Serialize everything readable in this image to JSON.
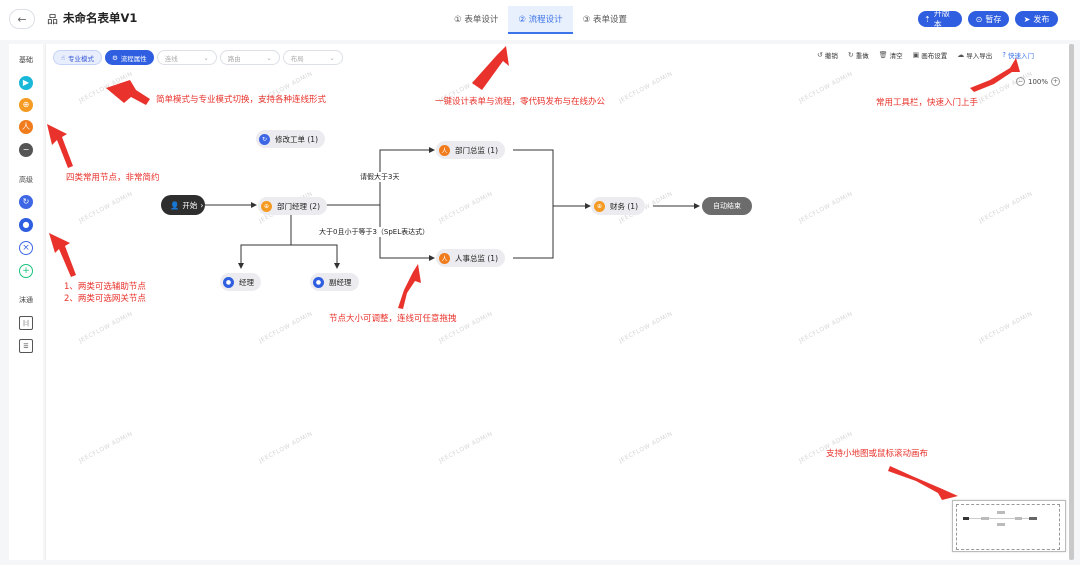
{
  "header": {
    "back_icon": "←",
    "form_icon": "品",
    "title": "未命名表单V1",
    "steps": [
      "① 表单设计",
      "② 流程设计",
      "③ 表单设置"
    ],
    "active_step": 1,
    "buttons": [
      {
        "icon": "⇡",
        "label": "升版本"
      },
      {
        "icon": "⊙",
        "label": "暂存"
      },
      {
        "icon": "➤",
        "label": "发布"
      }
    ]
  },
  "sidebar": {
    "sections": [
      "基础",
      "高级",
      "沫通"
    ]
  },
  "toolbar": {
    "mode_simple": "专业模式",
    "mode_pro": "流程属性",
    "selects": [
      "连线",
      "路由",
      "布局"
    ],
    "tools": [
      {
        "icon": "↺",
        "label": "撤销"
      },
      {
        "icon": "↻",
        "label": "重做"
      },
      {
        "icon": "🗑",
        "label": "清空"
      },
      {
        "icon": "▣",
        "label": "画布设置"
      },
      {
        "icon": "☁",
        "label": "导入导出"
      },
      {
        "icon": "?",
        "label": "快速入门"
      }
    ],
    "zoom": "100%"
  },
  "flow": {
    "start": "开始",
    "end": "自动结束",
    "nodes": {
      "modify": "修改工单 (1)",
      "dept_manager": "部门经理 (2)",
      "dept_director": "部门总监 (1)",
      "hr_director": "人事总监 (1)",
      "finance": "财务 (1)",
      "manager": "经理",
      "vice_manager": "副经理"
    },
    "edge_labels": {
      "leave_gt3": "请假大于3天",
      "leave_range": "大于0且小于等于3（SpEL表达式）"
    }
  },
  "annotations": {
    "mode_switch": "简单模式与专业模式切换，支持各种连线形式",
    "one_click": "一键设计表单与流程，零代码发布与在线办公",
    "toolbar_tip": "常用工具栏，快速入门上手",
    "four_nodes": "四类常用节点，非常简约",
    "aux_nodes_1": "1、两类可选辅助节点",
    "aux_nodes_2": "2、两类可选网关节点",
    "resizable": "节点大小可调整，连线可任意拖拽",
    "minimap_tip": "支持小地图或鼠标滚动画布"
  },
  "watermark": "JEECFLOW ADMIN",
  "colors": {
    "primary": "#2f5fe0",
    "annotation": "#e8322b",
    "orange": "#f59a23",
    "green": "#19c37d",
    "cyan": "#1ab8d8"
  }
}
